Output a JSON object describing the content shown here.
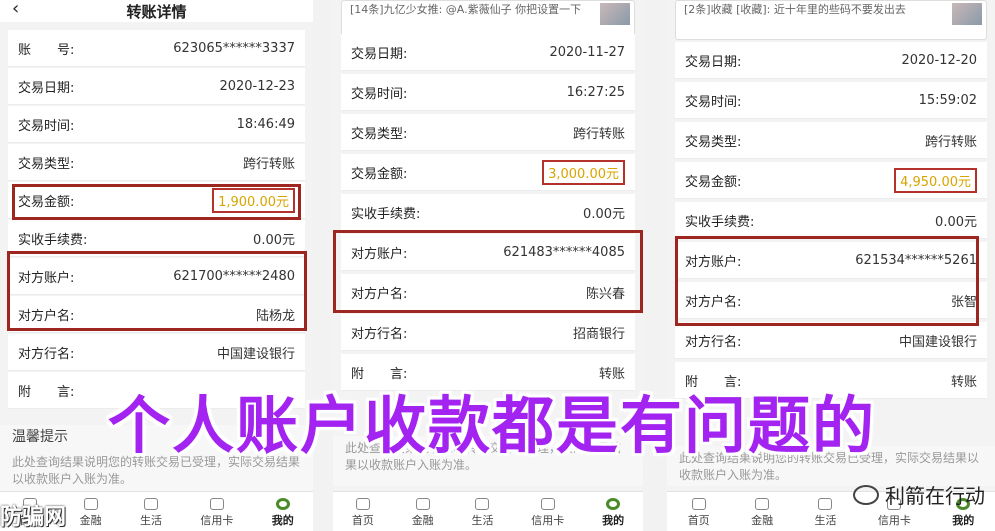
{
  "panel1": {
    "title": "转账详情",
    "back_icon": "‹",
    "rows": [
      {
        "label": "账　　号:",
        "value": "623065******3337"
      },
      {
        "label": "交易日期:",
        "value": "2020-12-23"
      },
      {
        "label": "交易时间:",
        "value": "18:46:49"
      },
      {
        "label": "交易类型:",
        "value": "跨行转账"
      },
      {
        "label": "交易金额:",
        "value": "1,900.00元"
      },
      {
        "label": "实收手续费:",
        "value": "0.00元"
      },
      {
        "label": "对方账户:",
        "value": "621700******2480"
      },
      {
        "label": "对方户名:",
        "value": "陆杨龙"
      },
      {
        "label": "对方行名:",
        "value": "中国建设银行"
      },
      {
        "label": "附　　言:",
        "value": ""
      }
    ],
    "tip_title": "温馨提示",
    "tip_text": "此处查询结果说明您的转账交易已受理，实际交易结果以收款账户入账为准。"
  },
  "panel2": {
    "notice": "[14条]九亿少女推: @A.紫薇仙子 你把设置一下",
    "rows": [
      {
        "label": "交易日期:",
        "value": "2020-11-27"
      },
      {
        "label": "交易时间:",
        "value": "16:27:25"
      },
      {
        "label": "交易类型:",
        "value": "跨行转账"
      },
      {
        "label": "交易金额:",
        "value": "3,000.00元"
      },
      {
        "label": "实收手续费:",
        "value": "0.00元"
      },
      {
        "label": "对方账户:",
        "value": "621483******4085"
      },
      {
        "label": "对方户名:",
        "value": "陈兴春"
      },
      {
        "label": "对方行名:",
        "value": "招商银行"
      },
      {
        "label": "附　　言:",
        "value": "转账"
      }
    ],
    "tip_text": "此处查询结果说明您的转账交易已受理，实际交易结果以收款账户入账为准。"
  },
  "panel3": {
    "notice": "[2条]收藏 [收藏]: 近十年里的些码不要发出去",
    "rows": [
      {
        "label": "交易日期:",
        "value": "2020-12-20"
      },
      {
        "label": "交易时间:",
        "value": "15:59:02"
      },
      {
        "label": "交易类型:",
        "value": "跨行转账"
      },
      {
        "label": "交易金额:",
        "value": "4,950.00元"
      },
      {
        "label": "实收手续费:",
        "value": "0.00元"
      },
      {
        "label": "对方账户:",
        "value": "621534******5261"
      },
      {
        "label": "对方户名:",
        "value": "张智"
      },
      {
        "label": "对方行名:",
        "value": "中国建设银行"
      },
      {
        "label": "附　　言:",
        "value": "转账"
      }
    ],
    "tip_text": "此处查询结果说明您的转账交易已受理，实际交易结果以收款账户入账为准。"
  },
  "tabs": [
    "首页",
    "金融",
    "生活",
    "信用卡",
    "我的"
  ],
  "caption": "个人账户收款都是有问题的",
  "watermark": "防骗网",
  "brand": "利箭在行动",
  "colors": {
    "highlight_box": "#9e2620",
    "amount": "#d9a400",
    "caption": "#a323f0"
  }
}
